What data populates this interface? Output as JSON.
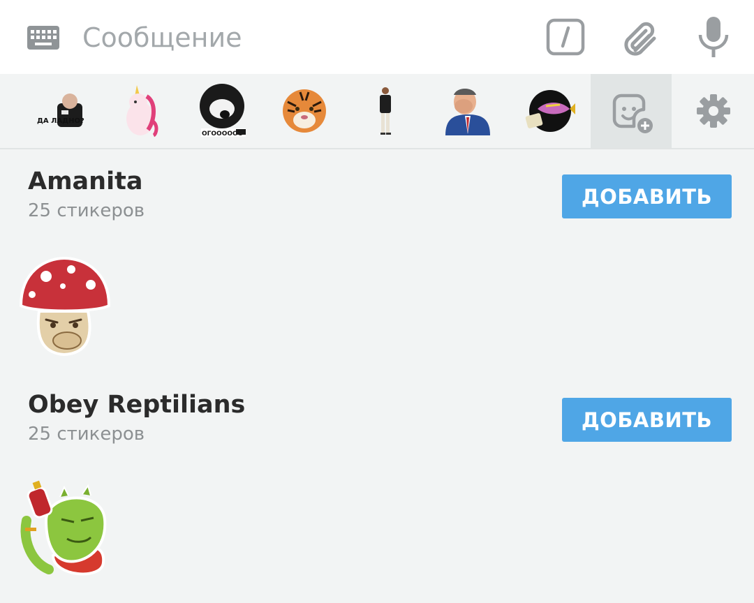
{
  "composer": {
    "placeholder": "Сообщение",
    "keyboard_icon": "keyboard-icon",
    "command_icon": "bot-command-icon",
    "attach_icon": "paperclip-icon",
    "mic_icon": "microphone-icon"
  },
  "sticker_tabs": {
    "items": [
      {
        "name": "sticker-tab-da-ladno",
        "caption": "ДА ЛАДНО?"
      },
      {
        "name": "sticker-tab-unicorn"
      },
      {
        "name": "sticker-tab-ogo",
        "caption": "ОГОООООО"
      },
      {
        "name": "sticker-tab-tiger"
      },
      {
        "name": "sticker-tab-man-standing"
      },
      {
        "name": "sticker-tab-facepalm"
      },
      {
        "name": "sticker-tab-fish"
      }
    ],
    "add_icon": "add-sticker-icon",
    "settings_icon": "gear-icon"
  },
  "packs": [
    {
      "title": "Amanita",
      "count": "25 стикеров",
      "button": "ДОБАВИТЬ"
    },
    {
      "title": "Obey Reptilians",
      "count": "25 стикеров",
      "button": "ДОБАВИТЬ"
    }
  ],
  "colors": {
    "accent": "#4fa6e6",
    "background": "#f2f4f4",
    "icon_gray": "#9e9e9e"
  }
}
